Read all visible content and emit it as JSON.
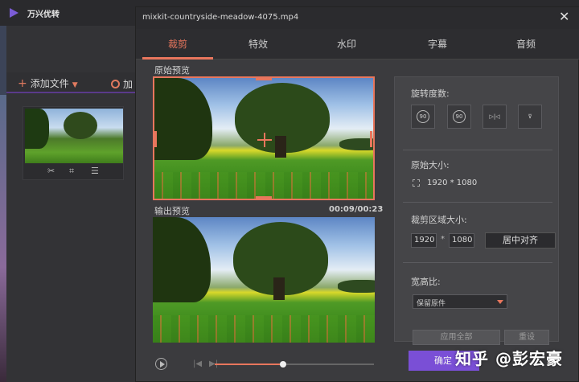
{
  "app": {
    "title": "万兴优转",
    "add_file_label": "添加文件",
    "add_more_label": "加"
  },
  "dialog": {
    "title": "mixkit-countryside-meadow-4075.mp4",
    "tabs": [
      {
        "label": "裁剪",
        "active": true
      },
      {
        "label": "特效",
        "active": false
      },
      {
        "label": "水印",
        "active": false
      },
      {
        "label": "字幕",
        "active": false
      },
      {
        "label": "音频",
        "active": false
      }
    ],
    "original_preview_label": "原始预览",
    "output_preview_label": "输出预览",
    "time": "00:09/00:23",
    "progress_fraction": 0.43,
    "rotate": {
      "label": "旋转度数:",
      "buttons": [
        {
          "name": "rotate-left-90-button",
          "text": "90"
        },
        {
          "name": "rotate-right-90-button",
          "text": "90"
        },
        {
          "name": "flip-horizontal-button",
          "text": "▷|◁"
        },
        {
          "name": "flip-vertical-button",
          "text": "⊽"
        }
      ]
    },
    "original_size": {
      "label": "原始大小:",
      "value": "1920 * 1080"
    },
    "crop_area": {
      "label": "裁剪区域大小:",
      "width": "1920",
      "height": "1080",
      "separator": "*",
      "center_button": "居中对齐"
    },
    "aspect_ratio": {
      "label": "宽高比:",
      "selected": "保留原件"
    },
    "apply_all_button": "应用全部",
    "reset_button": "重设",
    "ok_button": "确定"
  },
  "watermark_text": "知乎 @彭宏豪",
  "colors": {
    "accent": "#e8765d",
    "primary_button": "#7a4fd6"
  }
}
